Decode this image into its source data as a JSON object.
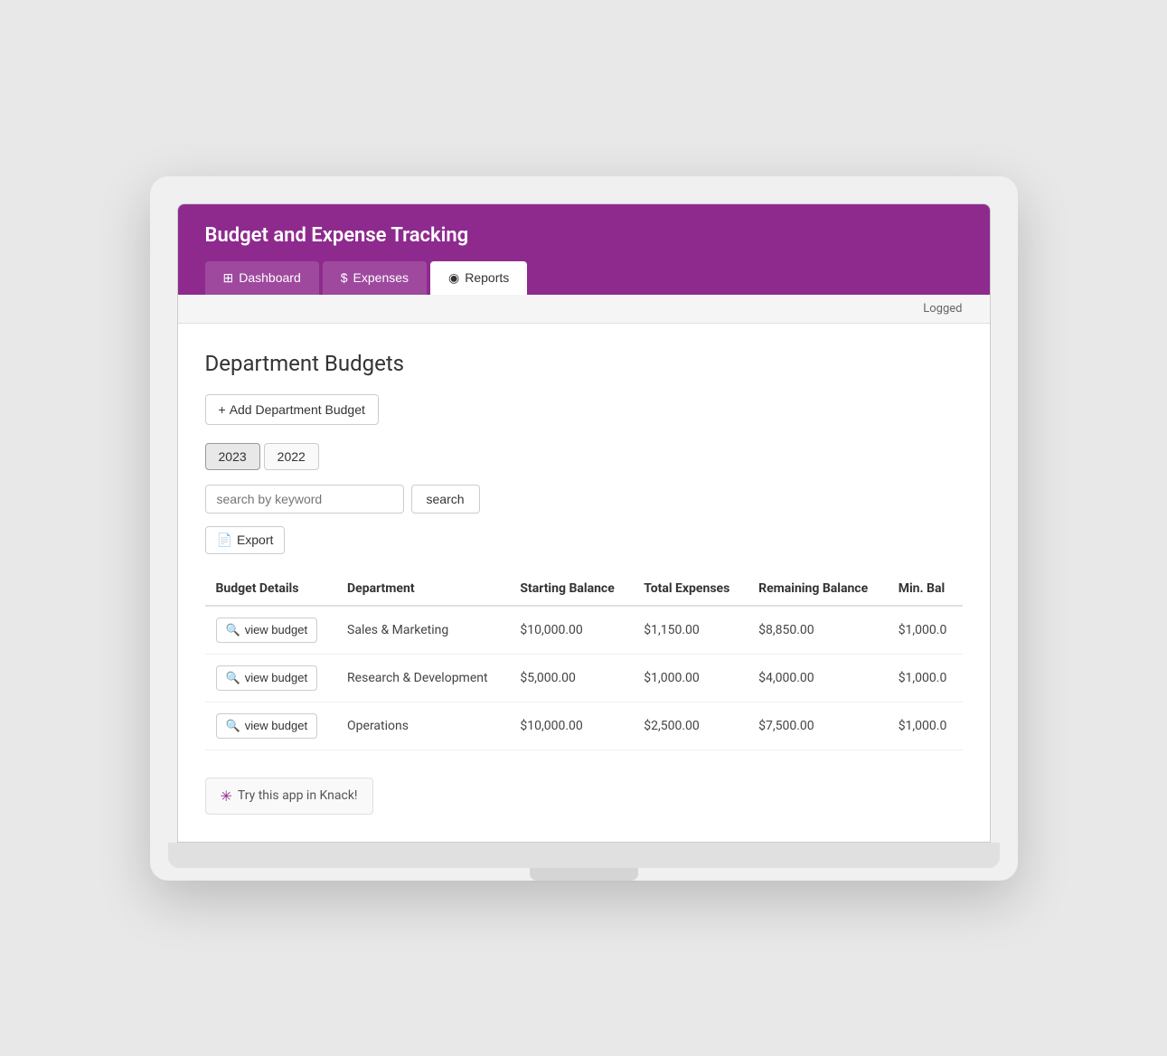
{
  "app": {
    "title": "Budget and Expense Tracking"
  },
  "nav": {
    "tabs": [
      {
        "id": "dashboard",
        "label": "Dashboard",
        "icon": "⊞",
        "active": false
      },
      {
        "id": "expenses",
        "label": "Expenses",
        "icon": "$",
        "active": false
      },
      {
        "id": "reports",
        "label": "Reports",
        "icon": "◉",
        "active": true
      }
    ]
  },
  "topbar": {
    "status": "Logged"
  },
  "main": {
    "page_title": "Department Budgets",
    "add_button_label": "+ Add Department Budget",
    "year_filters": [
      "2023",
      "2022"
    ],
    "active_year": "2023",
    "search_placeholder": "search by keyword",
    "search_button_label": "search",
    "export_button_label": "Export",
    "table": {
      "columns": [
        "Budget Details",
        "Department",
        "Starting Balance",
        "Total Expenses",
        "Remaining Balance",
        "Min. Bal"
      ],
      "rows": [
        {
          "view_label": "view budget",
          "department": "Sales & Marketing",
          "starting_balance": "$10,000.00",
          "total_expenses": "$1,150.00",
          "remaining_balance": "$8,850.00",
          "min_balance": "$1,000.0"
        },
        {
          "view_label": "view budget",
          "department": "Research & Development",
          "starting_balance": "$5,000.00",
          "total_expenses": "$1,000.00",
          "remaining_balance": "$4,000.00",
          "min_balance": "$1,000.0"
        },
        {
          "view_label": "view budget",
          "department": "Operations",
          "starting_balance": "$10,000.00",
          "total_expenses": "$2,500.00",
          "remaining_balance": "$7,500.00",
          "min_balance": "$1,000.0"
        }
      ]
    },
    "knack_label": "Try this app in Knack!"
  },
  "colors": {
    "header_bg": "#8e2a8e",
    "header_text": "#ffffff"
  }
}
